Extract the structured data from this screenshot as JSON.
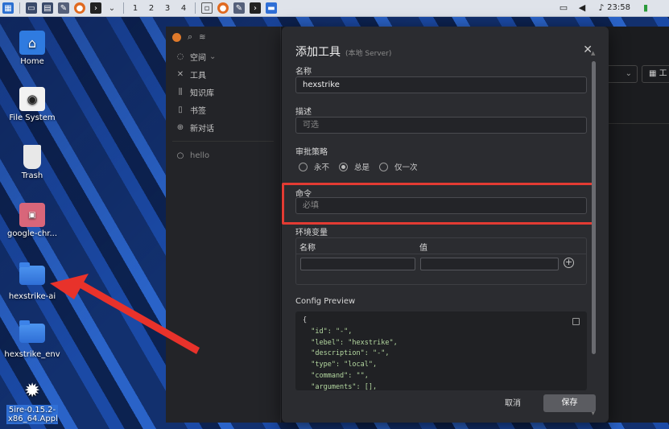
{
  "taskbar": {
    "workspaces": [
      "1",
      "2",
      "3",
      "4"
    ],
    "clock": "23:58"
  },
  "desktop": {
    "icons": [
      {
        "label": "Home",
        "icon": "home-icon"
      },
      {
        "label": "File System",
        "icon": "drive-icon"
      },
      {
        "label": "Trash",
        "icon": "trash-icon"
      },
      {
        "label": "google-chr...",
        "icon": "package-icon"
      },
      {
        "label": "hexstrike-ai",
        "icon": "folder-icon"
      },
      {
        "label": "hexstrike_env",
        "icon": "folder-icon"
      },
      {
        "label": "5ire-0.15.2-x86_64.Appl",
        "icon": "gear-icon"
      }
    ]
  },
  "app": {
    "sidebar": {
      "items": [
        {
          "label": "空间",
          "icon": "space-icon"
        },
        {
          "label": "工具",
          "icon": "tool-icon"
        },
        {
          "label": "知识库",
          "icon": "book-icon"
        },
        {
          "label": "书签",
          "icon": "bookmark-icon"
        },
        {
          "label": "新对话",
          "icon": "plus-circle-icon"
        }
      ],
      "chat": "hello"
    },
    "right_partial": "工"
  },
  "modal": {
    "title": "添加工具",
    "subtitle": "(本地 Server)",
    "name_label": "名称",
    "name_value": "hexstrike",
    "desc_label": "描述",
    "desc_placeholder": "可选",
    "approval_label": "审批策略",
    "approval_options": [
      "永不",
      "总是",
      "仅一次"
    ],
    "approval_selected": "总是",
    "command_label": "命令",
    "command_placeholder": "必填",
    "env_label": "环境变量",
    "env_name_header": "名称",
    "env_value_header": "值",
    "preview_label": "Config Preview",
    "preview_lines": [
      "{",
      "  \"id\": \"-\",",
      "  \"lebel\": \"hexstrike\",",
      "  \"description\": \"-\",",
      "  \"type\": \"local\",",
      "  \"command\": \"\",",
      "  \"arguments\": [],"
    ],
    "cancel": "取消",
    "save": "保存"
  }
}
